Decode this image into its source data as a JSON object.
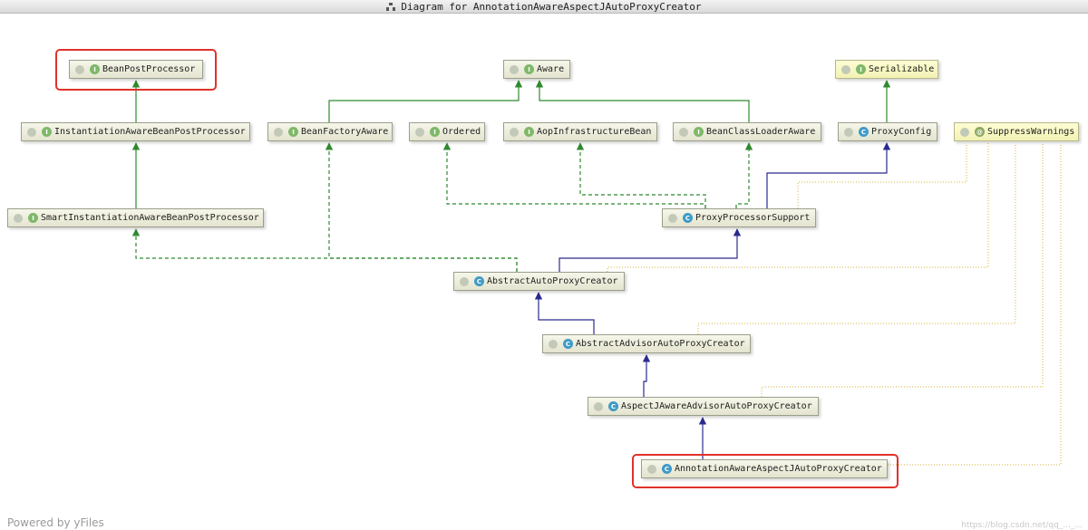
{
  "window": {
    "title": "Diagram for AnnotationAwareAspectJAutoProxyCreator"
  },
  "footer": "Powered by yFiles",
  "watermark": "https://blog.csdn.net/qq_..._...",
  "badge_letters": {
    "interface": "I",
    "class": "C",
    "annotation": "@"
  },
  "colors": {
    "implements": "#2f8a2f",
    "extends": "#2a2a8f",
    "annotation_link": "#e0c060",
    "highlight": "#e0322a"
  },
  "nodes": [
    {
      "id": "BeanPostProcessor",
      "label": "BeanPostProcessor",
      "kind": "interface"
    },
    {
      "id": "Aware",
      "label": "Aware",
      "kind": "interface"
    },
    {
      "id": "Serializable",
      "label": "Serializable",
      "kind": "interface"
    },
    {
      "id": "InstantiationAwareBeanPostProcessor",
      "label": "InstantiationAwareBeanPostProcessor",
      "kind": "interface"
    },
    {
      "id": "BeanFactoryAware",
      "label": "BeanFactoryAware",
      "kind": "interface"
    },
    {
      "id": "Ordered",
      "label": "Ordered",
      "kind": "interface"
    },
    {
      "id": "AopInfrastructureBean",
      "label": "AopInfrastructureBean",
      "kind": "interface"
    },
    {
      "id": "BeanClassLoaderAware",
      "label": "BeanClassLoaderAware",
      "kind": "interface"
    },
    {
      "id": "ProxyConfig",
      "label": "ProxyConfig",
      "kind": "class"
    },
    {
      "id": "SuppressWarnings",
      "label": "SuppressWarnings",
      "kind": "annotation"
    },
    {
      "id": "SmartInstantiationAwareBeanPostProcessor",
      "label": "SmartInstantiationAwareBeanPostProcessor",
      "kind": "interface"
    },
    {
      "id": "ProxyProcessorSupport",
      "label": "ProxyProcessorSupport",
      "kind": "class"
    },
    {
      "id": "AbstractAutoProxyCreator",
      "label": "AbstractAutoProxyCreator",
      "kind": "class"
    },
    {
      "id": "AbstractAdvisorAutoProxyCreator",
      "label": "AbstractAdvisorAutoProxyCreator",
      "kind": "class"
    },
    {
      "id": "AspectJAwareAdvisorAutoProxyCreator",
      "label": "AspectJAwareAdvisorAutoProxyCreator",
      "kind": "class"
    },
    {
      "id": "AnnotationAwareAspectJAutoProxyCreator",
      "label": "AnnotationAwareAspectJAutoProxyCreator",
      "kind": "class"
    }
  ],
  "edges": [
    {
      "from": "InstantiationAwareBeanPostProcessor",
      "to": "BeanPostProcessor",
      "type": "implements"
    },
    {
      "from": "SmartInstantiationAwareBeanPostProcessor",
      "to": "InstantiationAwareBeanPostProcessor",
      "type": "implements"
    },
    {
      "from": "BeanFactoryAware",
      "to": "Aware",
      "type": "implements"
    },
    {
      "from": "BeanClassLoaderAware",
      "to": "Aware",
      "type": "implements"
    },
    {
      "from": "ProxyConfig",
      "to": "Serializable",
      "type": "implements"
    },
    {
      "from": "AbstractAutoProxyCreator",
      "to": "SmartInstantiationAwareBeanPostProcessor",
      "type": "realizes"
    },
    {
      "from": "AbstractAutoProxyCreator",
      "to": "BeanFactoryAware",
      "type": "realizes"
    },
    {
      "from": "ProxyProcessorSupport",
      "to": "Ordered",
      "type": "realizes"
    },
    {
      "from": "ProxyProcessorSupport",
      "to": "AopInfrastructureBean",
      "type": "realizes"
    },
    {
      "from": "ProxyProcessorSupport",
      "to": "BeanClassLoaderAware",
      "type": "realizes"
    },
    {
      "from": "ProxyProcessorSupport",
      "to": "ProxyConfig",
      "type": "extends"
    },
    {
      "from": "AbstractAutoProxyCreator",
      "to": "ProxyProcessorSupport",
      "type": "extends"
    },
    {
      "from": "AbstractAdvisorAutoProxyCreator",
      "to": "AbstractAutoProxyCreator",
      "type": "extends"
    },
    {
      "from": "AspectJAwareAdvisorAutoProxyCreator",
      "to": "AbstractAdvisorAutoProxyCreator",
      "type": "extends"
    },
    {
      "from": "AnnotationAwareAspectJAutoProxyCreator",
      "to": "AspectJAwareAdvisorAutoProxyCreator",
      "type": "extends"
    },
    {
      "from": "ProxyProcessorSupport",
      "to": "SuppressWarnings",
      "type": "annotated"
    },
    {
      "from": "AbstractAutoProxyCreator",
      "to": "SuppressWarnings",
      "type": "annotated"
    },
    {
      "from": "AbstractAdvisorAutoProxyCreator",
      "to": "SuppressWarnings",
      "type": "annotated"
    },
    {
      "from": "AspectJAwareAdvisorAutoProxyCreator",
      "to": "SuppressWarnings",
      "type": "annotated"
    },
    {
      "from": "AnnotationAwareAspectJAutoProxyCreator",
      "to": "SuppressWarnings",
      "type": "annotated"
    }
  ],
  "highlighted": [
    "BeanPostProcessor",
    "AnnotationAwareAspectJAutoProxyCreator"
  ]
}
